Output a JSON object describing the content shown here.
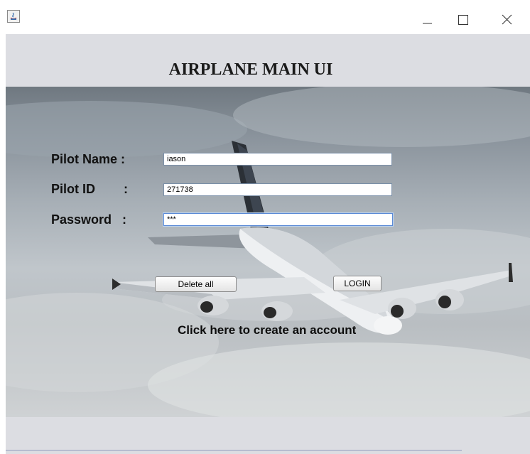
{
  "window": {
    "icons": {
      "app": "java-app-icon",
      "minimize": "minimize-icon",
      "maximize": "maximize-icon",
      "close": "close-icon"
    }
  },
  "header": {
    "title": "AIRPLANE MAIN UI"
  },
  "form": {
    "pilot_name_label": "Pilot Name :",
    "pilot_name_value": "iason",
    "pilot_id_label": "Pilot ID        :",
    "pilot_id_value": "271738",
    "password_label": "Password   :",
    "password_value": "***"
  },
  "buttons": {
    "delete_all": "Delete all",
    "login": "LOGIN"
  },
  "links": {
    "create_account": "Click here to create an account"
  },
  "colors": {
    "panel": "#dcdde2",
    "sky_top": "#6f7880",
    "sky_bottom": "#cfd2d4"
  }
}
